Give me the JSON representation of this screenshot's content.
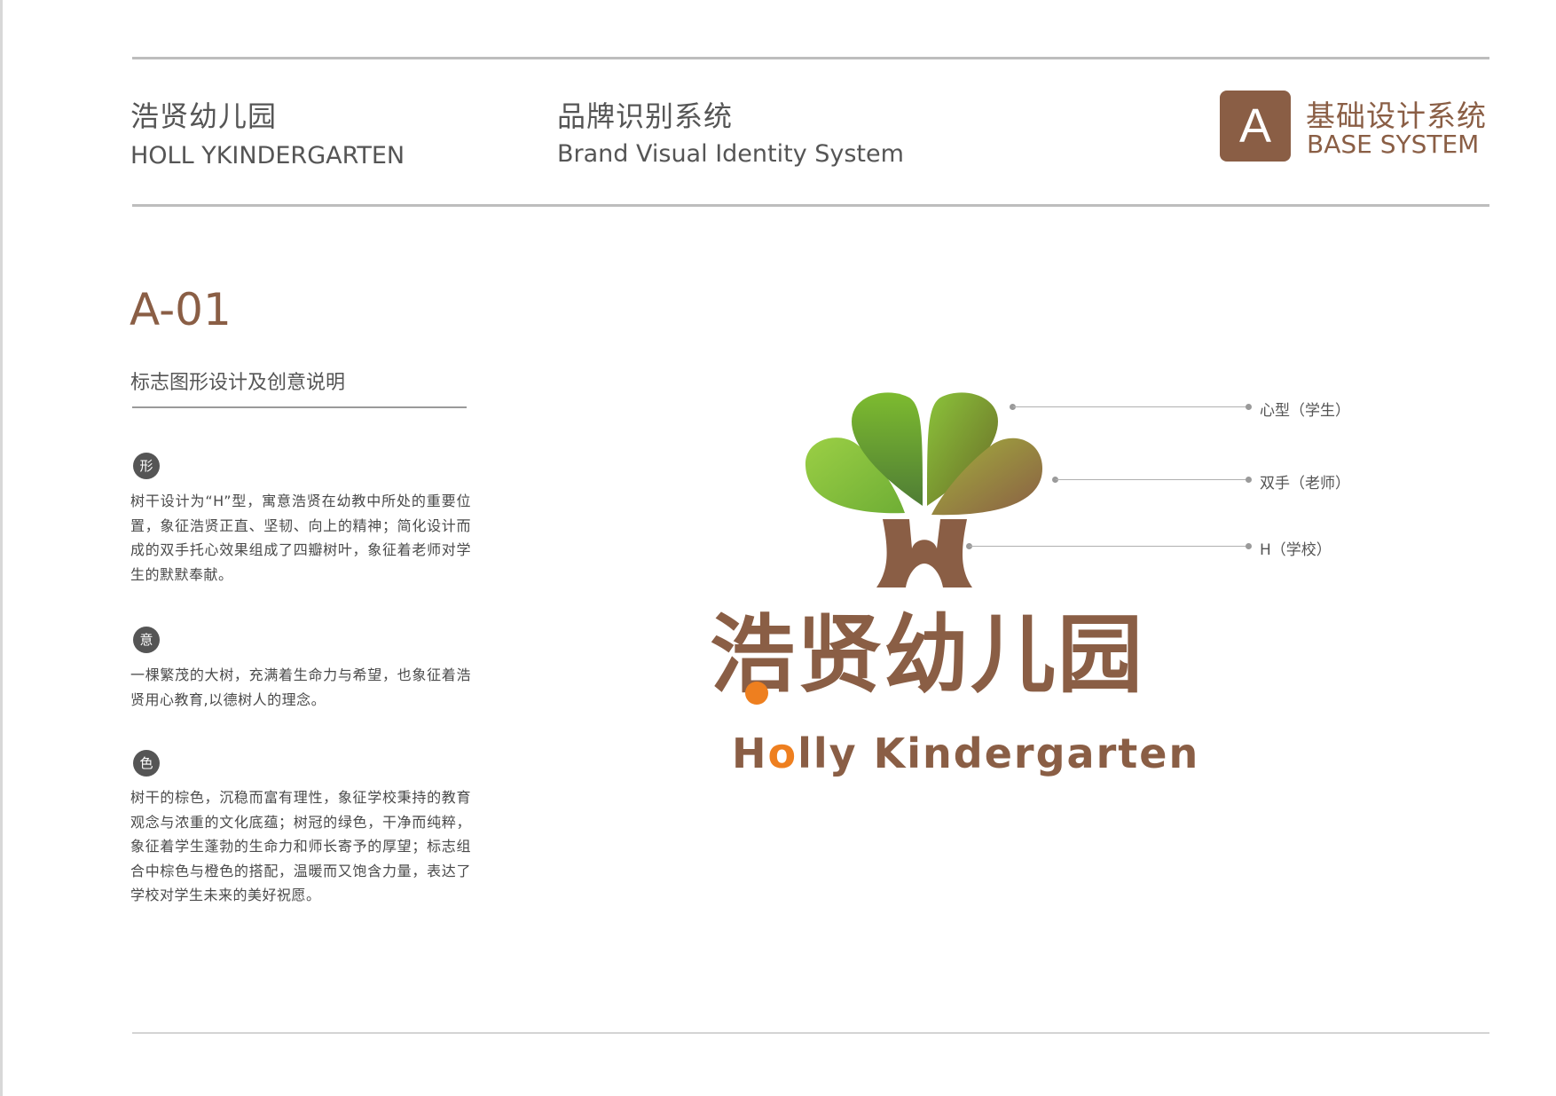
{
  "header": {
    "school_cn": "浩贤幼儿园",
    "school_en": "HOLL YKINDERGARTEN",
    "system_cn": "品牌识别系统",
    "system_en": "Brand Visual Identity System",
    "badge_letter": "A",
    "base_cn": "基础设计系统",
    "base_en": "BASE SYSTEM"
  },
  "page": {
    "code": "A-01",
    "subtitle": "标志图形设计及创意说明"
  },
  "sections": [
    {
      "icon": "形",
      "text": "树干设计为“H”型，寓意浩贤在幼教中所处的重要位置，象征浩贤正直、坚韧、向上的精神；简化设计而成的双手托心效果组成了四瓣树叶，象征着老师对学生的默默奉献。"
    },
    {
      "icon": "意",
      "text": "一棵繁茂的大树，充满着生命力与希望，也象征着浩贤用心教育,以德树人的理念。"
    },
    {
      "icon": "色",
      "text": "树干的棕色，沉稳而富有理性，象征学校秉持的教育观念与浓重的文化底蕴；树冠的绿色，干净而纯粹，象征着学生蓬勃的生命力和师长寄予的厚望；标志组合中棕色与橙色的搭配，温暖而又饱含力量，表达了学校对学生未来的美好祝愿。"
    }
  ],
  "callouts": [
    {
      "label": "心型（学生）"
    },
    {
      "label": "双手（老师）"
    },
    {
      "label": "H（学校）"
    }
  ],
  "logo": {
    "name_cn": "浩贤幼儿园",
    "name_en_part1": "H",
    "name_en_o": "o",
    "name_en_part2": "lly Kindergarten"
  },
  "colors": {
    "brown": "#8a5e45",
    "orange": "#ee7f1f",
    "green_light": "#8cc63f",
    "green_dark": "#5a8a2a",
    "gray_text": "#555555"
  }
}
